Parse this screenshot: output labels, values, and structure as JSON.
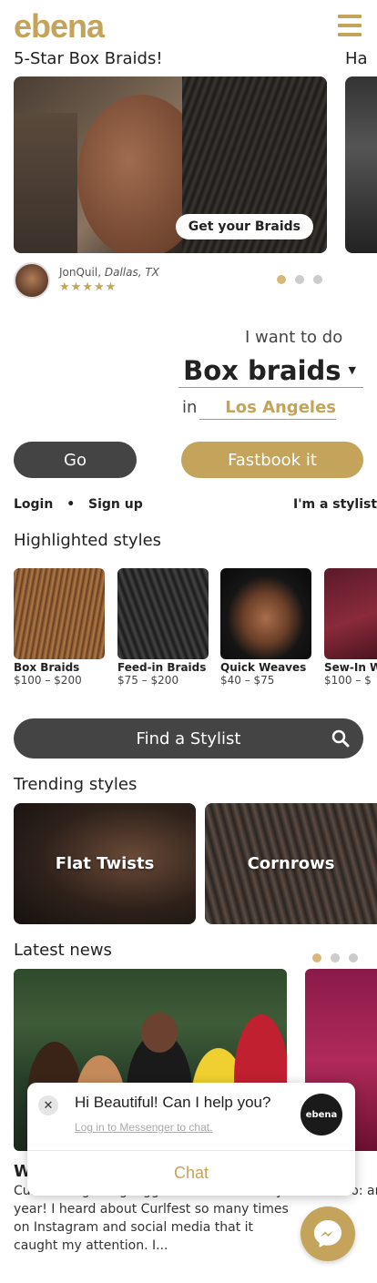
{
  "header": {
    "logo": "ebena"
  },
  "hero": {
    "title": "5-Star Box Braids!",
    "next_title": "Ha",
    "cta": "Get your Braids",
    "review": {
      "name": "JonQuil,",
      "location": "Dallas, TX",
      "stars": "★★★★★"
    }
  },
  "booking": {
    "want_label": "I want to do",
    "service": "Box braids",
    "in_label": "in",
    "city": "Los Angeles",
    "go_label": "Go",
    "fastbook_label": "Fastbook it"
  },
  "auth": {
    "login": "Login",
    "separator": "•",
    "signup": "Sign up",
    "stylist": "I'm a stylist"
  },
  "highlighted": {
    "title": "Highlighted styles",
    "items": [
      {
        "name": "Box Braids",
        "price": "$100 – $200"
      },
      {
        "name": "Feed-in Braids",
        "price": "$75 – $200"
      },
      {
        "name": "Quick Weaves",
        "price": "$40 – $75"
      },
      {
        "name": "Sew-In W",
        "price": "$100 – $"
      }
    ]
  },
  "find_stylist": {
    "label": "Find a Stylist"
  },
  "trending": {
    "title": "Trending styles",
    "items": [
      {
        "label": "Flat Twists"
      },
      {
        "label": "Cornrows"
      }
    ]
  },
  "news": {
    "title": "Latest news",
    "article_title": "W",
    "excerpt": "Curlfest is getting bigger and better every year! I heard about Curlfest so many times on Instagram and social media that it caught my attention. I...",
    "next_title": "ra",
    "next_excerpt": "Break to: an aging ...on."
  },
  "chat": {
    "message": "Hi Beautiful! Can I help you?",
    "login_link": "Log in to Messenger to chat.",
    "logo": "ebena",
    "button": "Chat"
  },
  "colors": {
    "brand_gold": "#c4a35a",
    "dark_button": "#444444"
  }
}
